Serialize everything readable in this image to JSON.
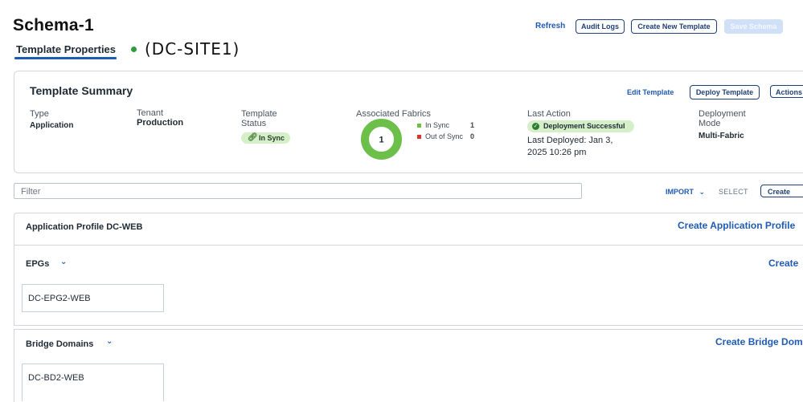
{
  "page": {
    "title": "Schema-1"
  },
  "tabs": {
    "active": "Template Properties"
  },
  "site": {
    "label": "(DC-SITE1)",
    "status_color": "#2e9d3a"
  },
  "toolbar": {
    "refresh": "Refresh",
    "audit_logs": "Audit Logs",
    "create_new_template": "Create New Template",
    "save_schema": "Save Schema"
  },
  "summary": {
    "title": "Template Summary",
    "edit_template": "Edit Template",
    "deploy_template": "Deploy Template",
    "actions": "Actions",
    "type": {
      "label": "Type",
      "value": "Application"
    },
    "tenant": {
      "label": "Tenant",
      "value": "Production"
    },
    "template_status": {
      "label_line1": "Template",
      "label_line2": "Status",
      "value": "In Sync"
    },
    "fabrics": {
      "label": "Associated Fabrics",
      "total": "1",
      "in_sync_label": "In Sync",
      "in_sync_count": "1",
      "out_of_sync_label": "Out of Sync",
      "out_of_sync_count": "0",
      "in_sync_color": "#6cc04a",
      "out_of_sync_color": "#d9342b"
    },
    "last_action": {
      "label": "Last Action",
      "badge": "Deployment Successful",
      "deployed_line1": "Last Deployed: Jan 3,",
      "deployed_line2": "2025 10:26 pm"
    },
    "deployment_mode": {
      "label_line1": "Deployment",
      "label_line2": "Mode",
      "value": "Multi-Fabric"
    }
  },
  "filterbar": {
    "placeholder": "Filter",
    "import": "IMPORT",
    "select": "SELECT",
    "create": "Create"
  },
  "app_profile": {
    "title": "Application Profile DC-WEB",
    "create_link": "Create Application Profile"
  },
  "epgs": {
    "title": "EPGs",
    "create_link": "Create",
    "items": [
      "DC-EPG2-WEB"
    ]
  },
  "bridge_domains": {
    "title": "Bridge Domains",
    "create_link": "Create Bridge Domain",
    "items": [
      "DC-BD2-WEB"
    ]
  }
}
